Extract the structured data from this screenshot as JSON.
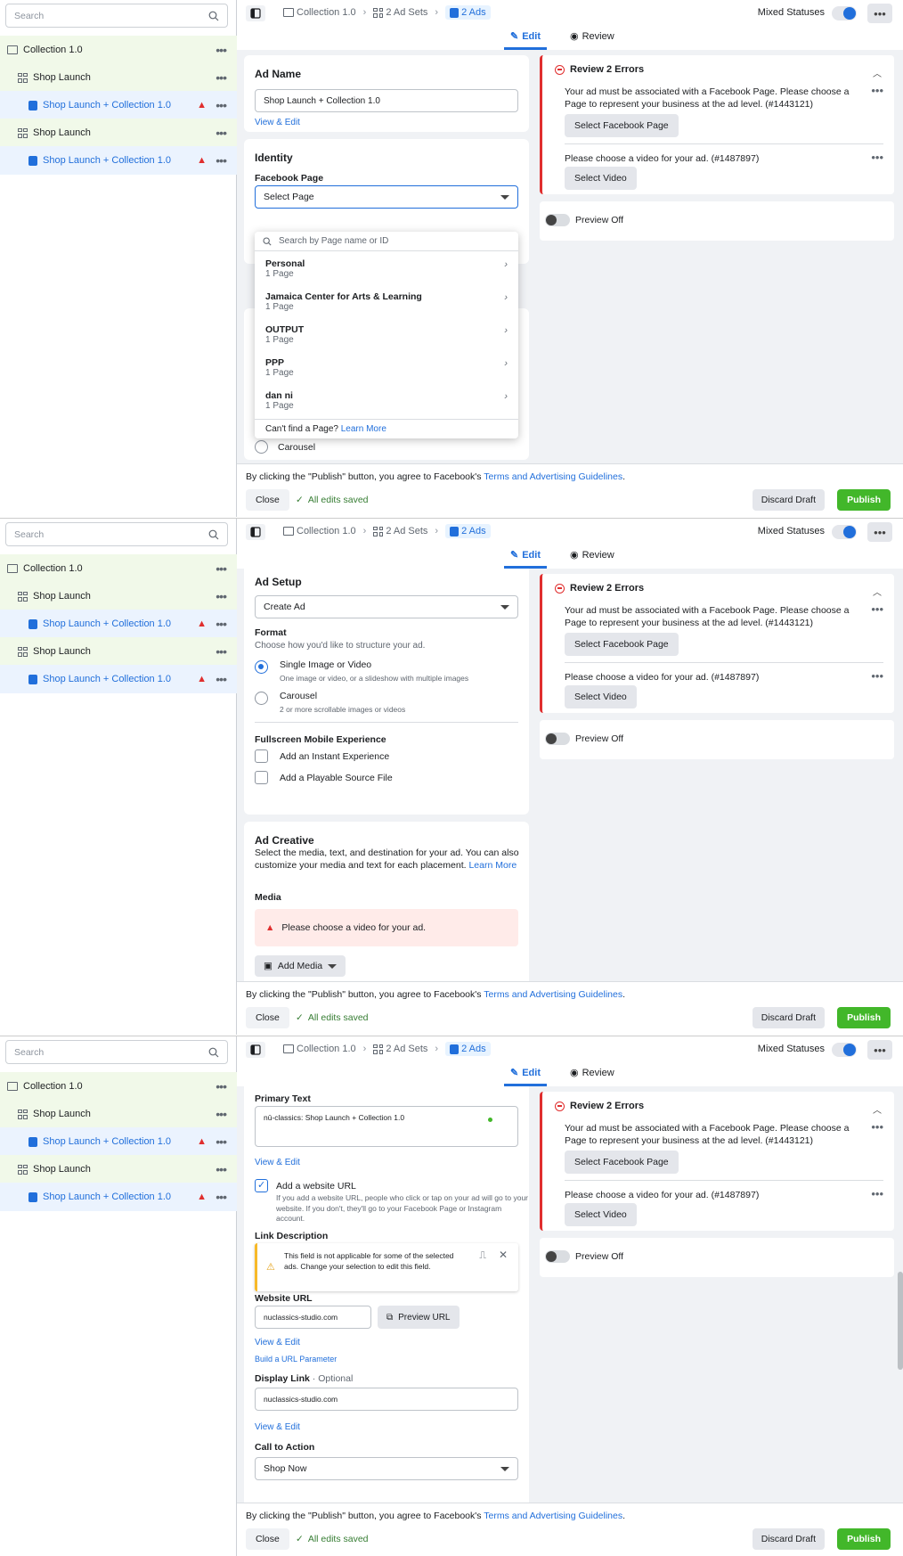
{
  "sidebar": {
    "search_placeholder": "Search",
    "items": [
      {
        "label": "Collection 1.0"
      },
      {
        "label": "Shop Launch"
      },
      {
        "label": "Shop Launch + Collection 1.0"
      },
      {
        "label": "Shop Launch"
      },
      {
        "label": "Shop Launch + Collection 1.0"
      }
    ]
  },
  "topbar": {
    "crumb_collection": "Collection 1.0",
    "crumb_adsets": "2 Ad Sets",
    "crumb_ads": "2 Ads",
    "mixed_statuses": "Mixed Statuses",
    "tab_edit": "Edit",
    "tab_review": "Review"
  },
  "review": {
    "title": "Review 2 Errors",
    "error1": "Your ad must be associated with a Facebook Page. Please choose a Page to represent your business at the ad level. (#1443121)",
    "error1_button": "Select Facebook Page",
    "error2": "Please choose a video for your ad. (#1487897)",
    "error2_button": "Select Video",
    "preview_label": "Preview Off"
  },
  "footer": {
    "terms_prefix": "By clicking the \"Publish\" button, you agree to Facebook's",
    "terms_link": "Terms and Advertising Guidelines",
    "terms_suffix": ".",
    "close": "Close",
    "saved": "All edits saved",
    "discard": "Discard Draft",
    "publish": "Publish"
  },
  "panel1": {
    "ad_name_title": "Ad Name",
    "ad_name_value": "Shop Launch + Collection 1.0",
    "view_edit": "View & Edit",
    "identity_title": "Identity",
    "facebook_page_label": "Facebook Page",
    "select_page": "Select Page",
    "search_placeholder": "Search by Page name or ID",
    "pages": [
      {
        "name": "Personal",
        "count": "1 Page"
      },
      {
        "name": "Jamaica Center for Arts & Learning",
        "count": "1 Page"
      },
      {
        "name": "OUTPUT",
        "count": "1 Page"
      },
      {
        "name": "PPP",
        "count": "1 Page"
      },
      {
        "name": "dan ni",
        "count": "1 Page"
      }
    ],
    "cant_find": "Can't find a Page?",
    "learn_more": "Learn More",
    "carousel_label": "Carousel"
  },
  "panel2": {
    "ad_setup_title": "Ad Setup",
    "create_ad": "Create Ad",
    "format_label": "Format",
    "format_desc": "Choose how you'd like to structure your ad.",
    "single_label": "Single Image or Video",
    "single_desc": "One image or video, or a slideshow with multiple images",
    "carousel_label": "Carousel",
    "carousel_desc": "2 or more scrollable images or videos",
    "fullscreen_label": "Fullscreen Mobile Experience",
    "instant_label": "Add an Instant Experience",
    "playable_label": "Add a Playable Source File",
    "creative_title": "Ad Creative",
    "creative_desc": "Select the media, text, and destination for your ad. You can also customize your media and text for each placement.",
    "learn_more": "Learn More",
    "media_label": "Media",
    "media_error": "Please choose a video for your ad.",
    "add_media": "Add Media"
  },
  "panel3": {
    "primary_text_label": "Primary Text",
    "primary_text_value": "nū-classics: Shop Launch + Collection 1.0",
    "view_edit": "View & Edit",
    "website_url_check": "Add a website URL",
    "website_url_desc": "If you add a website URL, people who click or tap on your ad will go to your website. If you don't, they'll go to your Facebook Page or Instagram account.",
    "link_desc_label": "Link Description",
    "link_desc_warning": "This field is not applicable for some of the selected ads. Change your selection to edit this field.",
    "website_url_label": "Website URL",
    "website_url_value": "nuclassics-studio.com",
    "preview_url": "Preview URL",
    "build_param": "Build a URL Parameter",
    "display_link_label": "Display Link",
    "optional": "· Optional",
    "display_link_value": "nuclassics-studio.com",
    "cta_label": "Call to Action",
    "cta_value": "Shop Now"
  },
  "colors": {
    "accent": "#216fdb",
    "error": "#e02e2e",
    "publish": "#42b72a",
    "tree_bg": "#f1f9e9",
    "selected_bg": "#ebf3fe"
  }
}
